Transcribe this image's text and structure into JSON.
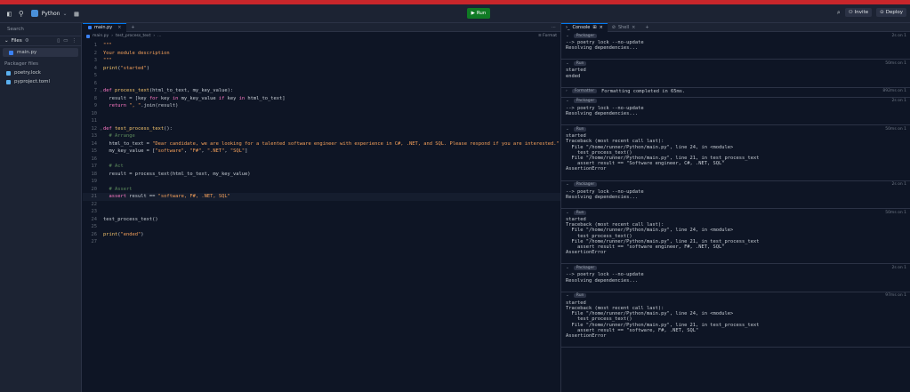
{
  "topbar": {
    "project_name": "Python",
    "run_label": "Run",
    "invite_label": "Invite",
    "deploy_label": "Deploy"
  },
  "sidebar": {
    "search_placeholder": "Search",
    "files_label": "Files",
    "files": [
      {
        "name": "main.py",
        "active": true
      }
    ],
    "packager_label": "Packager files",
    "packager_files": [
      {
        "name": "poetry.lock"
      },
      {
        "name": "pyproject.toml"
      }
    ]
  },
  "editor": {
    "tab_label": "main.py",
    "breadcrumb": [
      "main.py",
      "test_process_text",
      "..."
    ],
    "format_label": "Format",
    "lines": [
      [
        {
          "t": "\"\"\"",
          "c": "str"
        }
      ],
      [
        {
          "t": "Your module description",
          "c": "str"
        }
      ],
      [
        {
          "t": "\"\"\"",
          "c": "str"
        }
      ],
      [
        {
          "t": "print",
          "c": "fn"
        },
        {
          "t": "(",
          "c": "txt"
        },
        {
          "t": "\"started\"",
          "c": "str"
        },
        {
          "t": ")",
          "c": "txt"
        }
      ],
      [],
      [],
      [
        {
          "t": "def ",
          "c": "kw"
        },
        {
          "t": "process_text",
          "c": "fn"
        },
        {
          "t": "(html_to_text, my_key_value):",
          "c": "txt"
        }
      ],
      [
        {
          "t": "  result = [key ",
          "c": "txt"
        },
        {
          "t": "for",
          "c": "kw"
        },
        {
          "t": " key ",
          "c": "txt"
        },
        {
          "t": "in",
          "c": "kw"
        },
        {
          "t": " my_key_value ",
          "c": "txt"
        },
        {
          "t": "if",
          "c": "kw"
        },
        {
          "t": " key ",
          "c": "txt"
        },
        {
          "t": "in",
          "c": "kw"
        },
        {
          "t": " html_to_text]",
          "c": "txt"
        }
      ],
      [
        {
          "t": "  return ",
          "c": "kw"
        },
        {
          "t": "\", \"",
          "c": "str"
        },
        {
          "t": ".join(result)",
          "c": "txt"
        }
      ],
      [],
      [],
      [
        {
          "t": "def ",
          "c": "kw"
        },
        {
          "t": "test_process_text",
          "c": "fn"
        },
        {
          "t": "():",
          "c": "txt"
        }
      ],
      [
        {
          "t": "  # Arrange",
          "c": "cm"
        }
      ],
      [
        {
          "t": "  html_to_text = ",
          "c": "txt"
        },
        {
          "t": "\"Dear candidate, we are looking for a talented software engineer with experience in C#, .NET, and SQL. Please respond if you are interested.\"",
          "c": "str"
        }
      ],
      [
        {
          "t": "  my_key_value = [",
          "c": "txt"
        },
        {
          "t": "\"software\"",
          "c": "str"
        },
        {
          "t": ", ",
          "c": "txt"
        },
        {
          "t": "\"F#\"",
          "c": "str"
        },
        {
          "t": ", ",
          "c": "txt"
        },
        {
          "t": "\".NET\"",
          "c": "str"
        },
        {
          "t": ", ",
          "c": "txt"
        },
        {
          "t": "\"SQL\"",
          "c": "str"
        },
        {
          "t": "]",
          "c": "txt"
        }
      ],
      [],
      [
        {
          "t": "  # Act",
          "c": "cm"
        }
      ],
      [
        {
          "t": "  result = process_text(html_to_text, my_key_value)",
          "c": "txt"
        }
      ],
      [],
      [
        {
          "t": "  # Assert",
          "c": "cm"
        }
      ],
      [
        {
          "t": "  assert",
          "c": "kw"
        },
        {
          "t": " result == ",
          "c": "txt"
        },
        {
          "t": "\"software, F#, .NET, SQL\"",
          "c": "str"
        }
      ],
      [],
      [],
      [
        {
          "t": "test_process_text()",
          "c": "txt"
        }
      ],
      [],
      [
        {
          "t": "print",
          "c": "fn"
        },
        {
          "t": "(",
          "c": "txt"
        },
        {
          "t": "\"ended\"",
          "c": "str"
        },
        {
          "t": ")",
          "c": "txt"
        }
      ],
      []
    ]
  },
  "console": {
    "tab_console": "Console",
    "tab_shell": "Shell",
    "entries": [
      {
        "badge": "Packager",
        "time": "2s on 1",
        "out": "--> poetry lock --no-update\nResolving dependencies..."
      },
      {
        "badge": "Run",
        "time": "50ms on 1",
        "out": "started\nended"
      },
      {
        "badge": "Formatter",
        "msg": "Formatting completed in 65ms.",
        "time": "892ms on 1",
        "collapsed": true
      },
      {
        "badge": "Packager",
        "time": "2s on 1",
        "out": "--> poetry lock --no-update\nResolving dependencies..."
      },
      {
        "badge": "Run",
        "time": "50ms on 1",
        "out": "started\nTraceback (most recent call last):\n  File \"/home/runner/Python/main.py\", line 24, in <module>\n    test_process_text()\n  File \"/home/runner/Python/main.py\", line 21, in test_process_text\n    assert result == \"Software engineer, C#, .NET, SQL\"\nAssertionError"
      },
      {
        "badge": "Packager",
        "time": "2s on 1",
        "out": "--> poetry lock --no-update\nResolving dependencies..."
      },
      {
        "badge": "Run",
        "time": "50ms on 1",
        "out": "started\nTraceback (most recent call last):\n  File \"/home/runner/Python/main.py\", line 24, in <module>\n    test_process_text()\n  File \"/home/runner/Python/main.py\", line 21, in test_process_text\n    assert result == \"software engineer, F#, .NET, SQL\"\nAssertionError"
      },
      {
        "badge": "Packager",
        "time": "2s on 1",
        "out": "--> poetry lock --no-update\nResolving dependencies..."
      },
      {
        "badge": "Run",
        "time": "97ms on 1",
        "out": "started\nTraceback (most recent call last):\n  File \"/home/runner/Python/main.py\", line 24, in <module>\n    test_process_text()\n  File \"/home/runner/Python/main.py\", line 21, in test_process_text\n    assert result == \"software, F#, .NET, SQL\"\nAssertionError"
      }
    ]
  }
}
